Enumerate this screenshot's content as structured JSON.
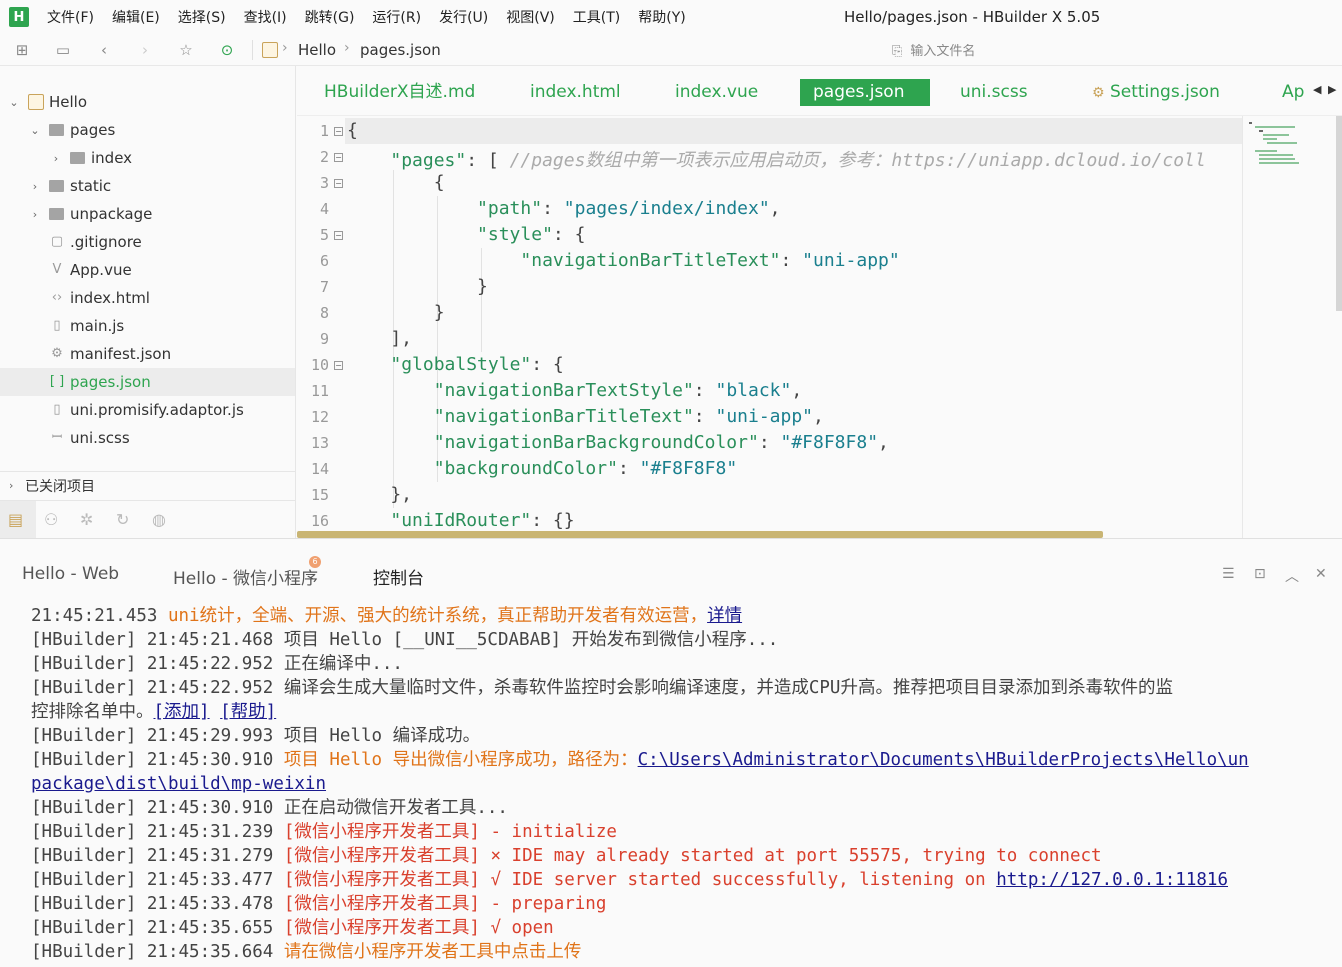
{
  "app": {
    "logo_text": "H",
    "window_title": "Hello/pages.json - HBuilder X 5.05",
    "accent_color": "#2ea44f"
  },
  "menu": {
    "items": [
      "文件(F)",
      "编辑(E)",
      "选择(S)",
      "查找(I)",
      "跳转(G)",
      "运行(R)",
      "发行(U)",
      "视图(V)",
      "工具(T)",
      "帮助(Y)"
    ]
  },
  "toolbar": {
    "icons": [
      "new-file-icon",
      "save-icon",
      "back-icon",
      "forward-icon",
      "star-icon",
      "run-icon"
    ],
    "breadcrumb": [
      "Hello",
      "pages.json"
    ],
    "file_search_placeholder": "输入文件名"
  },
  "sidebar": {
    "tree": [
      {
        "label": "Hello",
        "icon": "project-icon",
        "arrow": "down"
      },
      {
        "label": "pages",
        "icon": "folder-icon",
        "arrow": "down"
      },
      {
        "label": "index",
        "icon": "folder-icon",
        "arrow": "right"
      },
      {
        "label": "static",
        "icon": "folder-icon",
        "arrow": "right"
      },
      {
        "label": "unpackage",
        "icon": "folder-icon",
        "arrow": "right"
      },
      {
        "label": ".gitignore",
        "icon": "file-icon"
      },
      {
        "label": "App.vue",
        "icon": "vue-file-icon"
      },
      {
        "label": "index.html",
        "icon": "html-file-icon"
      },
      {
        "label": "main.js",
        "icon": "js-file-icon"
      },
      {
        "label": "manifest.json",
        "icon": "manifest-icon"
      },
      {
        "label": "pages.json",
        "icon": "json-file-icon",
        "selected": true
      },
      {
        "label": "uni.promisify.adaptor.js",
        "icon": "js-file-icon"
      },
      {
        "label": "uni.scss",
        "icon": "scss-file-icon"
      }
    ],
    "closed_projects_label": "已关闭项目",
    "bottom_icons": [
      "project-manager-icon",
      "plugin-icon",
      "debug-icon",
      "git-icon",
      "browser-icon"
    ]
  },
  "tabs": [
    {
      "label": "HBuilderX自述.md"
    },
    {
      "label": "index.html"
    },
    {
      "label": "index.vue"
    },
    {
      "label": "pages.json",
      "active": true
    },
    {
      "label": "uni.scss"
    },
    {
      "label": "Settings.json",
      "icon": "gear-icon"
    },
    {
      "label": "Ap"
    }
  ],
  "editor": {
    "line_numbers": [
      "1",
      "2",
      "3",
      "4",
      "5",
      "6",
      "7",
      "8",
      "9",
      "10",
      "11",
      "12",
      "13",
      "14",
      "15",
      "16"
    ],
    "lines": [
      "{",
      "    \"pages\": [ //pages数组中第一项表示应用启动页，参考：https://uniapp.dcloud.io/coll",
      "        {",
      "            \"path\": \"pages/index/index\",",
      "            \"style\": {",
      "                \"navigationBarTitleText\": \"uni-app\"",
      "            }",
      "        }",
      "    ],",
      "    \"globalStyle\": {",
      "        \"navigationBarTextStyle\": \"black\",",
      "        \"navigationBarTitleText\": \"uni-app\",",
      "        \"navigationBarBackgroundColor\": \"#F8F8F8\",",
      "        \"backgroundColor\": \"#F8F8F8\"",
      "    },",
      "    \"uniIdRouter\": {}"
    ]
  },
  "console": {
    "tabs": [
      {
        "label": "Hello - Web"
      },
      {
        "label": "Hello - 微信小程序",
        "badge": "6"
      },
      {
        "label": "控制台",
        "active": true
      }
    ],
    "tool_icons": [
      "filter-icon",
      "export-icon",
      "collapse-icon",
      "close-all-icon"
    ],
    "lines": {
      "l1_time": "21:45:21.453 ",
      "l1_msg": "uni统计，全端、开源、强大的统计系统，真正帮助开发者有效运营，",
      "l1_link": "详情",
      "l2": "[HBuilder] 21:45:21.468 项目 Hello [__UNI__5CDABAB] 开始发布到微信小程序...",
      "l3": "[HBuilder] 21:45:22.952 正在编译中...",
      "l4a": "[HBuilder] 21:45:22.952 编译会生成大量临时文件，杀毒软件监控时会影响编译速度，并造成CPU升高。推荐把项目目录添加到杀毒软件的监",
      "l4b": "控排除名单中。",
      "l4_link1": "[添加]",
      "l4_link2": "[帮助]",
      "l5": "[HBuilder] 21:45:29.993 项目 Hello 编译成功。",
      "l6_prefix": "[HBuilder] 21:45:30.910 ",
      "l6_msg": "项目 Hello 导出微信小程序成功，路径为：",
      "l6_link_a": "C:\\Users\\Administrator\\Documents\\HBuilderProjects\\Hello\\un",
      "l6_link_b": "package\\dist\\build\\mp-weixin",
      "l7": "[HBuilder] 21:45:30.910 正在启动微信开发者工具...",
      "l8_prefix": "[HBuilder] 21:45:31.239 ",
      "l8_msg": "[微信小程序开发者工具] - initialize",
      "l9_prefix": "[HBuilder] 21:45:31.279 ",
      "l9_msg": "[微信小程序开发者工具] × IDE may already started at port 55575, trying to connect",
      "l10_prefix": "[HBuilder] 21:45:33.477 ",
      "l10_msg": "[微信小程序开发者工具] √ IDE server started successfully, listening on ",
      "l10_link": "http://127.0.0.1:11816",
      "l11_prefix": "[HBuilder] 21:45:33.478 ",
      "l11_msg": "[微信小程序开发者工具] - preparing",
      "l12_prefix": "[HBuilder] 21:45:35.655 ",
      "l12_msg": "[微信小程序开发者工具] √ open",
      "l13_prefix": "[HBuilder] 21:45:35.664 ",
      "l13_msg": "请在微信小程序开发者工具中点击上传"
    }
  }
}
